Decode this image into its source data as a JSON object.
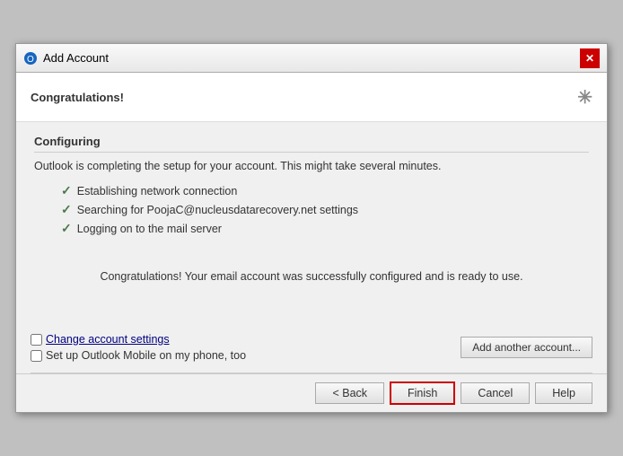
{
  "window": {
    "title": "Add Account",
    "icon": "outlook-icon"
  },
  "congratulations_bar": {
    "label": "Congratulations!"
  },
  "configuring": {
    "section_title": "Configuring",
    "intro_text": "Outlook is completing the setup for your account. This might take several minutes.",
    "steps": [
      {
        "text": "Establishing network connection",
        "done": true
      },
      {
        "text": "Searching for PoojaC@nucleusdatarecovery.net settings",
        "done": true
      },
      {
        "text": "Logging on to the mail server",
        "done": true
      }
    ],
    "success_message": "Congratulations! Your email account was successfully configured and is ready to use."
  },
  "options": {
    "change_account_label": "Change account settings",
    "mobile_label": "Set up Outlook Mobile on my phone, too",
    "add_another_label": "Add another account..."
  },
  "footer": {
    "back_label": "< Back",
    "finish_label": "Finish",
    "cancel_label": "Cancel",
    "help_label": "Help"
  }
}
